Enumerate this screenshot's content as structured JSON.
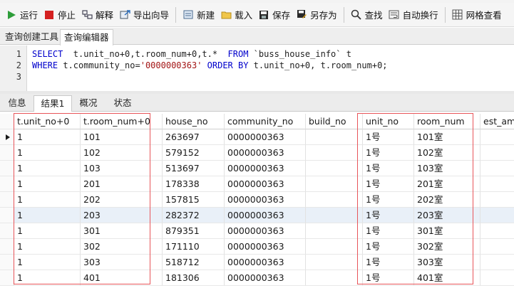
{
  "toolbar": {
    "buttons": [
      {
        "label": "运行",
        "icon": "run-icon"
      },
      {
        "label": "停止",
        "icon": "stop-icon"
      },
      {
        "label": "解释",
        "icon": "explain-icon"
      },
      {
        "label": "导出向导",
        "icon": "export-wizard-icon"
      },
      {
        "label": "新建",
        "icon": "new-icon"
      },
      {
        "label": "载入",
        "icon": "load-icon"
      },
      {
        "label": "保存",
        "icon": "save-icon"
      },
      {
        "label": "另存为",
        "icon": "save-as-icon"
      },
      {
        "label": "查找",
        "icon": "find-icon"
      },
      {
        "label": "自动换行",
        "icon": "word-wrap-icon"
      },
      {
        "label": "网格查看",
        "icon": "grid-view-icon"
      }
    ]
  },
  "doc_tabs": [
    "查询创建工具",
    "查询编辑器"
  ],
  "editor": {
    "line_numbers": [
      "1",
      "2",
      "3"
    ],
    "line1": {
      "kw1": "SELECT",
      "plain1": "  t.unit_no+0,t.room_num+0,t.*  ",
      "kw2": "FROM",
      "plain2": " `buss_house_info` t"
    },
    "line2": {
      "kw1": "WHERE",
      "plain1": " t.community_no=",
      "str": "'0000000363'",
      "plain2": " ",
      "kw2": "ORDER BY",
      "plain3": " t.unit_no+0, t.room_num+0;"
    }
  },
  "result_tabs": [
    "信息",
    "结果1",
    "概况",
    "状态"
  ],
  "grid": {
    "columns": [
      "t.unit_no+0",
      "t.room_num+0",
      "house_no",
      "community_no",
      "build_no",
      "unit_no",
      "room_num",
      "est_amo"
    ],
    "rows": [
      [
        "1",
        "101",
        "263697",
        "0000000363",
        "",
        "1号",
        "101室",
        ""
      ],
      [
        "1",
        "102",
        "579152",
        "0000000363",
        "",
        "1号",
        "102室",
        ""
      ],
      [
        "1",
        "103",
        "513697",
        "0000000363",
        "",
        "1号",
        "103室",
        ""
      ],
      [
        "1",
        "201",
        "178338",
        "0000000363",
        "",
        "1号",
        "201室",
        ""
      ],
      [
        "1",
        "202",
        "157815",
        "0000000363",
        "",
        "1号",
        "202室",
        ""
      ],
      [
        "1",
        "203",
        "282372",
        "0000000363",
        "",
        "1号",
        "203室",
        ""
      ],
      [
        "1",
        "301",
        "879351",
        "0000000363",
        "",
        "1号",
        "301室",
        ""
      ],
      [
        "1",
        "302",
        "171110",
        "0000000363",
        "",
        "1号",
        "302室",
        ""
      ],
      [
        "1",
        "303",
        "518712",
        "0000000363",
        "",
        "1号",
        "303室",
        ""
      ],
      [
        "1",
        "401",
        "181306",
        "0000000363",
        "",
        "1号",
        "401室",
        ""
      ]
    ],
    "highlight_color": "#e8555a",
    "selected_row_color": "#e9f0f8"
  }
}
